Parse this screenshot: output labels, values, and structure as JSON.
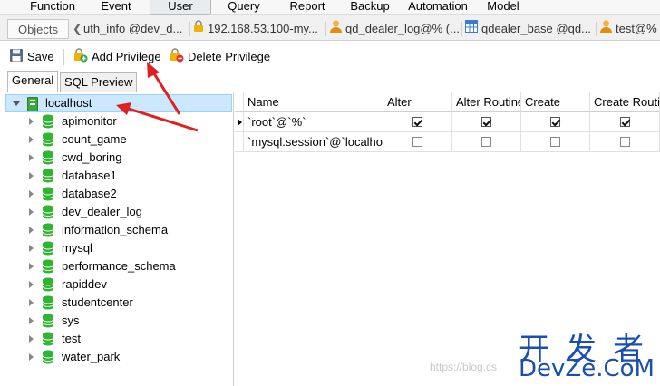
{
  "menu": [
    {
      "label": "Function"
    },
    {
      "label": "Event"
    },
    {
      "label": "User"
    },
    {
      "label": "Query"
    },
    {
      "label": "Report"
    },
    {
      "label": "Backup"
    },
    {
      "label": "Automation"
    },
    {
      "label": "Model"
    }
  ],
  "tabs": {
    "objects": "Objects",
    "items": [
      {
        "label": "uth_info @dev_d...",
        "icon": "back-arrow-icon"
      },
      {
        "label": "192.168.53.100-my...",
        "icon": "lock-icon"
      },
      {
        "label": "qd_dealer_log@% (...",
        "icon": "user-icon"
      },
      {
        "label": "qdealer_base @qd...",
        "icon": "table-icon"
      },
      {
        "label": "test@% (...",
        "icon": "user-icon"
      }
    ]
  },
  "toolbar": {
    "save_label": "Save",
    "add_privilege_label": "Add Privilege",
    "delete_privilege_label": "Delete Privilege"
  },
  "subtabs": {
    "general": "General",
    "sql_preview": "SQL Preview"
  },
  "tree": {
    "root": "localhost",
    "databases": [
      "apimonitor",
      "count_game",
      "cwd_boring",
      "database1",
      "database2",
      "dev_dealer_log",
      "information_schema",
      "mysql",
      "performance_schema",
      "rapiddev",
      "studentcenter",
      "sys",
      "test",
      "water_park"
    ]
  },
  "grid": {
    "columns": [
      "Name",
      "Alter",
      "Alter Routine",
      "Create",
      "Create Routi"
    ],
    "rows": [
      {
        "name": "`root`@`%`",
        "values": [
          true,
          true,
          true,
          true
        ],
        "current": true
      },
      {
        "name": "`mysql.session`@`localhos",
        "values": [
          false,
          false,
          false,
          false
        ],
        "current": false
      }
    ]
  },
  "watermark": {
    "url": "https://blog.cs",
    "cn": "开发者",
    "en": "DevZe.CoM"
  },
  "colors": {
    "arrow": "#e02020",
    "db_icon": "#2fb52f",
    "selection": "#cce8ff",
    "watermark": "#1a4fb0"
  }
}
